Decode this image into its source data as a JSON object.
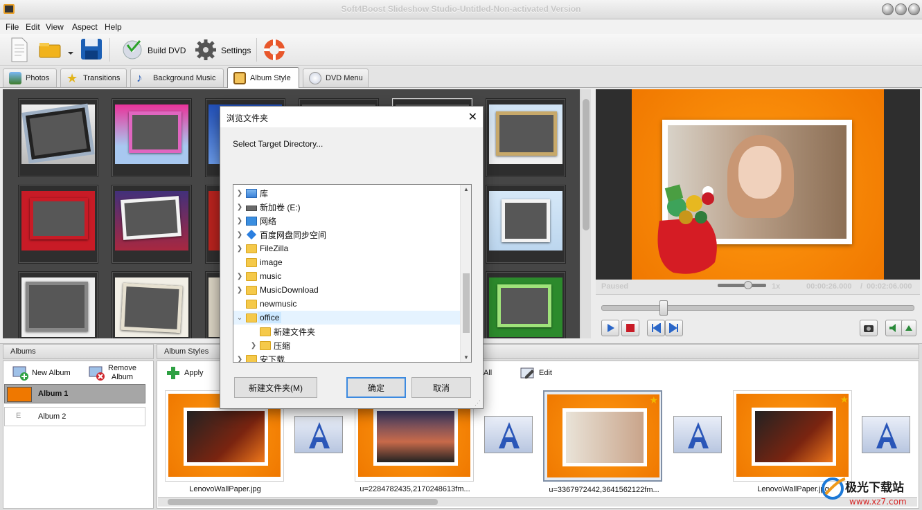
{
  "window": {
    "title": "Soft4Boost Slideshow Studio-Untitled-Non-activated Version"
  },
  "menu": [
    "File",
    "Edit",
    "View",
    "Aspect",
    "Help"
  ],
  "toolbar": {
    "build_dvd": "Build DVD",
    "settings": "Settings"
  },
  "tabs": [
    {
      "label": "Photos",
      "active": false
    },
    {
      "label": "Transitions",
      "active": false
    },
    {
      "label": "Background Music",
      "active": false
    },
    {
      "label": "Album Style",
      "active": true
    },
    {
      "label": "DVD Menu",
      "active": false
    }
  ],
  "player": {
    "status": "Paused",
    "speed": "1x",
    "current_time": "00:00:26.000",
    "separator": "/",
    "total_time": "00:02:06.000",
    "progress": 0.2,
    "volume": 0.6
  },
  "albums": {
    "header": "Albums",
    "new_album": "New Album",
    "remove_album_1": "Remove",
    "remove_album_2": "Album",
    "items": [
      {
        "label": "Album 1",
        "selected": true
      },
      {
        "label": "Album 2",
        "selected": false
      }
    ]
  },
  "album_styles": {
    "header": "Album Styles",
    "apply": "Apply",
    "apply_all_suffix": "All",
    "edit": "Edit"
  },
  "slides": [
    {
      "name": "LenovoWallPaper.jpg",
      "selected": false
    },
    {
      "name": "u=2284782435,2170248613fm...",
      "selected": false
    },
    {
      "name": "u=3367972442,3641562122fm...",
      "selected": true
    },
    {
      "name": "LenovoWallPaper.jpg",
      "selected": false
    }
  ],
  "dialog": {
    "title": "浏览文件夹",
    "close_glyph": "✕",
    "prompt": "Select Target Directory...",
    "tree": [
      {
        "label": "库",
        "level": 0,
        "expander": ">",
        "icon": "library-icon"
      },
      {
        "label": "新加卷 (E:)",
        "level": 0,
        "expander": ">",
        "icon": "drive-icon"
      },
      {
        "label": "网络",
        "level": 0,
        "expander": ">",
        "icon": "network-icon"
      },
      {
        "label": "百度网盘同步空间",
        "level": 0,
        "expander": ">",
        "icon": "baidu-icon"
      },
      {
        "label": "FileZilla",
        "level": 0,
        "expander": ">",
        "icon": "folder-icon"
      },
      {
        "label": "image",
        "level": 0,
        "expander": "",
        "icon": "folder-icon"
      },
      {
        "label": "music",
        "level": 0,
        "expander": ">",
        "icon": "folder-icon"
      },
      {
        "label": "MusicDownload",
        "level": 0,
        "expander": ">",
        "icon": "folder-icon"
      },
      {
        "label": "newmusic",
        "level": 0,
        "expander": "",
        "icon": "folder-icon"
      },
      {
        "label": "office",
        "level": 0,
        "expander": "v",
        "icon": "folder-icon",
        "selected": true
      },
      {
        "label": "新建文件夹",
        "level": 1,
        "expander": "",
        "icon": "folder-icon"
      },
      {
        "label": "压缩",
        "level": 1,
        "expander": ">",
        "icon": "folder-icon"
      },
      {
        "label": "安下载",
        "level": 0,
        "expander": ">",
        "icon": "folder-icon"
      }
    ],
    "new_folder": "新建文件夹(M)",
    "ok": "确定",
    "cancel": "取消"
  },
  "watermark": {
    "brand": "极光下载站",
    "url": "www.xz7.com"
  },
  "colors": {
    "accent_orange": "#f07800",
    "selection_blue": "#cce8ff",
    "dialog_default_border": "#3c8ae0"
  }
}
